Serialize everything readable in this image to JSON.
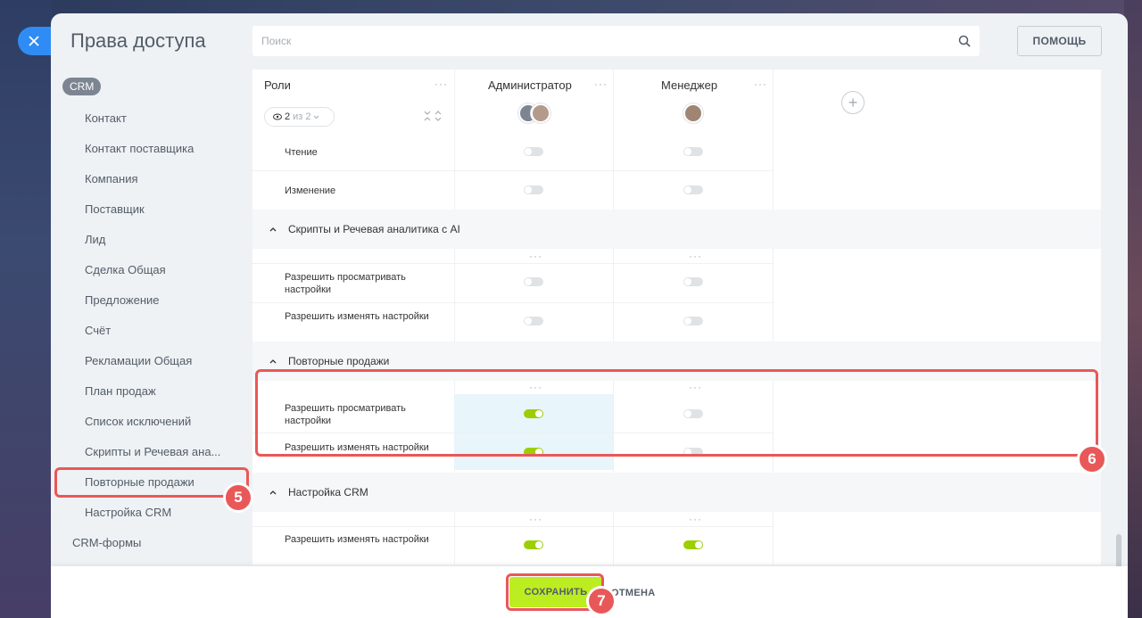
{
  "window": {
    "title": "Права доступа"
  },
  "search": {
    "placeholder": "Поиск"
  },
  "header": {
    "help_label": "ПОМОЩЬ"
  },
  "sidebar": {
    "group_label": "CRM",
    "items": [
      "Контакт",
      "Контакт поставщика",
      "Компания",
      "Поставщик",
      "Лид",
      "Сделка Общая",
      "Предложение",
      "Счёт",
      "Рекламации Общая",
      "План продаж",
      "Список исключений",
      "Скрипты и Речевая ана...",
      "Повторные продажи",
      "Настройка CRM"
    ],
    "bottom_item": "CRM-формы"
  },
  "table": {
    "roles_header": "Роли",
    "filter": {
      "selected": "2",
      "separator": "из",
      "total": "2"
    },
    "columns": [
      "Администратор",
      "Менеджер"
    ],
    "top_rows": [
      {
        "label": "Чтение",
        "values": [
          false,
          false
        ]
      },
      {
        "label": "Изменение",
        "values": [
          false,
          false
        ]
      }
    ],
    "sections": [
      {
        "title": "Скрипты и Речевая аналитика с AI",
        "rows": [
          {
            "label": "Разрешить просматривать настройки",
            "values": [
              false,
              false
            ]
          },
          {
            "label": "Разрешить изменять настройки",
            "values": [
              false,
              false
            ]
          }
        ]
      },
      {
        "title": "Повторные продажи",
        "rows": [
          {
            "label": "Разрешить просматривать настройки",
            "values": [
              true,
              false
            ]
          },
          {
            "label": "Разрешить изменять настройки",
            "values": [
              true,
              false
            ]
          }
        ]
      },
      {
        "title": "Настройка CRM",
        "rows": [
          {
            "label": "Разрешить изменять настройки",
            "values": [
              true,
              true
            ]
          }
        ]
      }
    ]
  },
  "annotations": {
    "badge_5": "5",
    "badge_6": "6",
    "badge_7": "7"
  },
  "footer": {
    "save_label": "СОХРАНИТЬ",
    "cancel_label": "ОТМЕНА"
  },
  "colors": {
    "accent": "#2f8cf5",
    "toggle_on": "#9dcf00",
    "save": "#bbed21",
    "highlight": "#e95858"
  }
}
